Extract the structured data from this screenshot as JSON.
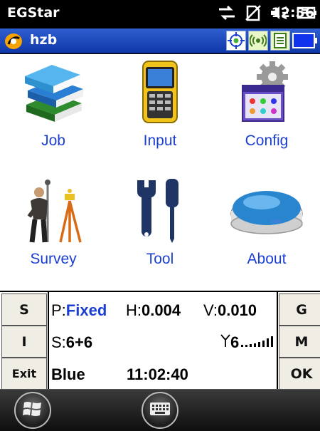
{
  "statusbar": {
    "app_name": "EGStar",
    "time": "12:56"
  },
  "titlebar": {
    "title": "hzb"
  },
  "menu": [
    {
      "label": "Job"
    },
    {
      "label": "Input"
    },
    {
      "label": "Config"
    },
    {
      "label": "Survey"
    },
    {
      "label": "Tool"
    },
    {
      "label": "About"
    }
  ],
  "panel": {
    "btn_s": "S",
    "btn_i": "I",
    "btn_exit": "Exit",
    "btn_g": "G",
    "btn_m": "M",
    "btn_ok": "OK",
    "p_prefix": "P:",
    "p_value": "Fixed",
    "h_prefix": "H:",
    "h_value": "0.004",
    "v_prefix": "V:",
    "v_value": "0.010",
    "s_prefix": "S:",
    "s_value": "6+6",
    "signal_value": "6",
    "mode": "Blue",
    "gps_time": "11:02:40"
  },
  "colors": {
    "label_blue": "#1b3fd2",
    "title_blue": "#0f37a8",
    "battery_blue": "#1133ee",
    "status_green": "#4caf3a"
  }
}
